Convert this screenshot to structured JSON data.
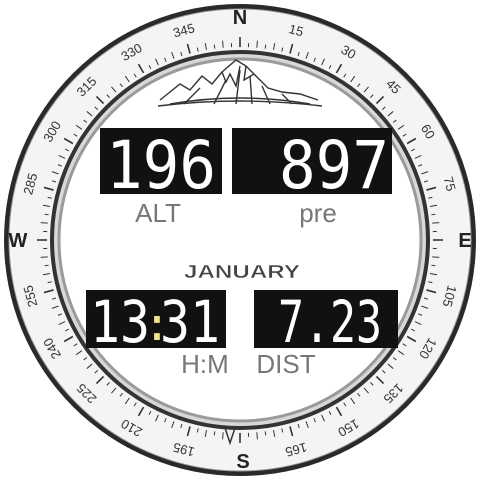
{
  "watch": {
    "bezel": {
      "cardinals": {
        "north": "N",
        "east": "E",
        "south": "S",
        "west": "W"
      },
      "degree_labels": [
        "15",
        "30",
        "45",
        "60",
        "75",
        "105",
        "120",
        "135",
        "150",
        "165",
        "195",
        "210",
        "225",
        "240",
        "255",
        "285",
        "300",
        "315",
        "330",
        "345"
      ]
    },
    "altitude": {
      "value": "196",
      "label": "ALT"
    },
    "pressure": {
      "value": "897",
      "label": "pre"
    },
    "date": {
      "month": "JANUARY"
    },
    "time": {
      "hours": "13",
      "minutes": "31",
      "separator": ":",
      "label": "H:M"
    },
    "distance": {
      "value": "7.23",
      "label": "DIST"
    },
    "colors": {
      "display_bg": "#111111",
      "digit": "#ffffff",
      "label": "#777777",
      "bezel_dark": "#222222",
      "bezel_light": "#f4f4f4"
    },
    "icons": {
      "logo": "mountain-range-icon",
      "pointer": "bezel-marker-icon"
    }
  }
}
